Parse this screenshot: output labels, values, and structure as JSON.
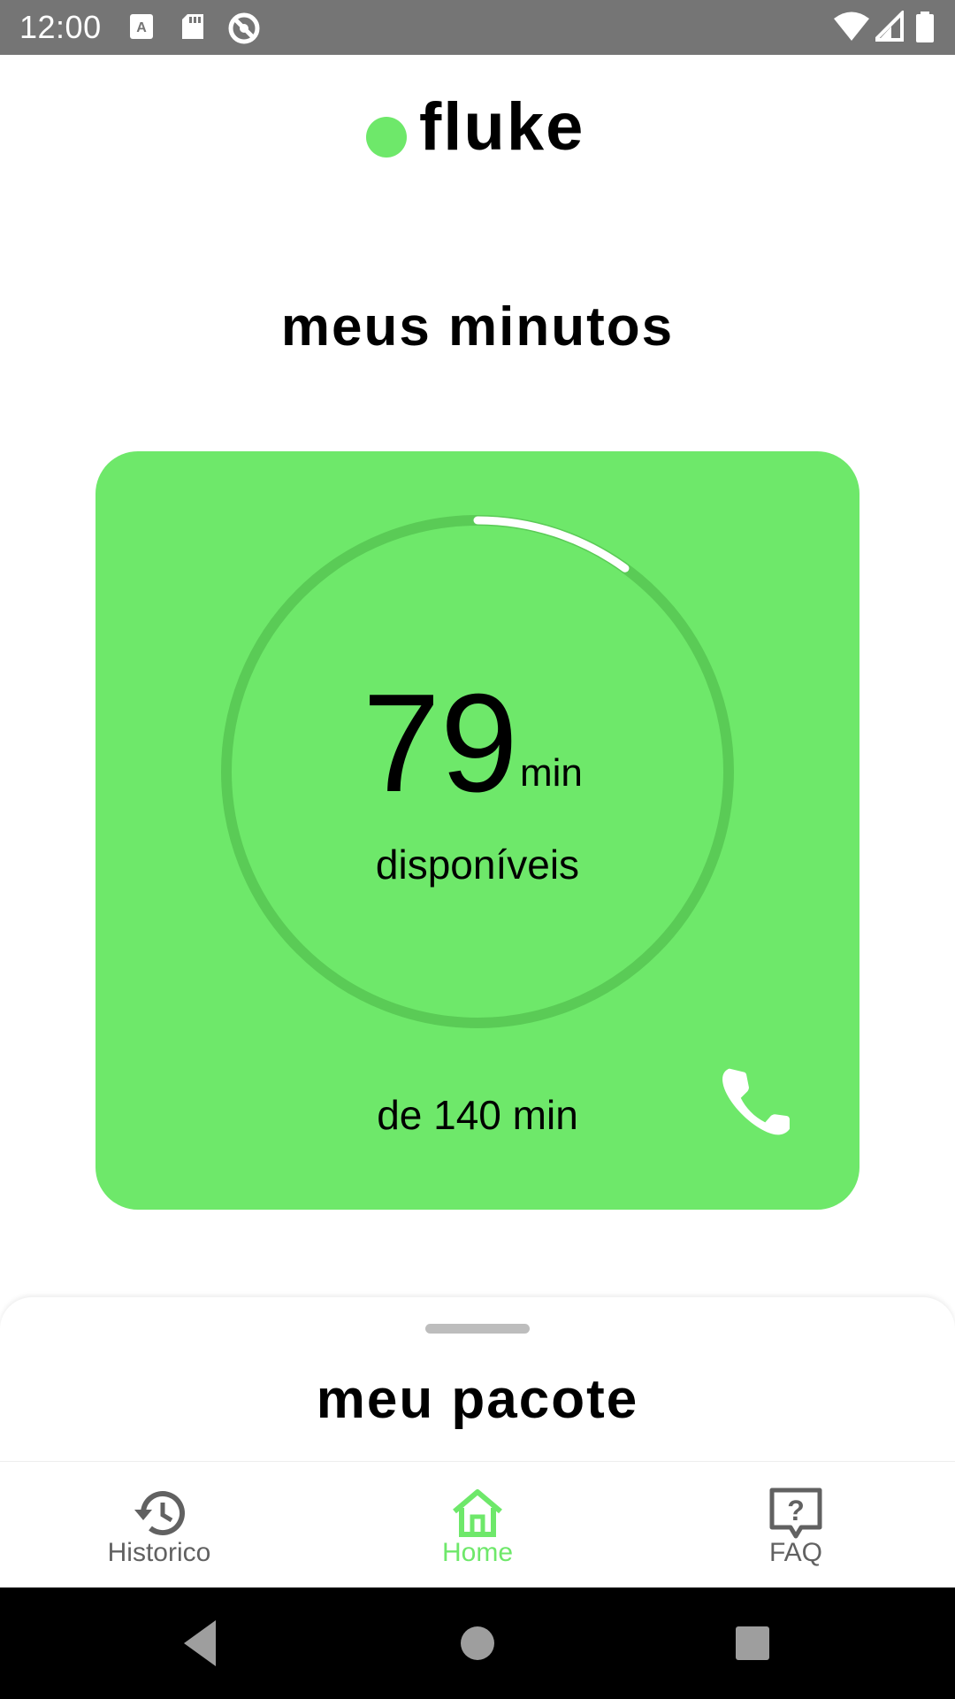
{
  "status_bar": {
    "time": "12:00",
    "icons": [
      "keyboard-icon",
      "sd-card-icon",
      "no-sync-icon",
      "wifi-icon",
      "signal-icon",
      "battery-icon"
    ]
  },
  "header": {
    "logo_text": "fluke",
    "logo_dot_color": "#6ee86a"
  },
  "main": {
    "title": "meus minutos",
    "card": {
      "background_color": "#6ee86a",
      "minutes_value": "79",
      "minutes_unit": "min",
      "available_label": "disponíveis",
      "total_label": "de 140 min",
      "used_fraction": 0.1,
      "action_icon": "phone-icon"
    }
  },
  "sheet": {
    "title": "meu pacote"
  },
  "bottom_nav": {
    "items": [
      {
        "label": "Historico",
        "icon": "history-icon",
        "active": false
      },
      {
        "label": "Home",
        "icon": "home-icon",
        "active": true
      },
      {
        "label": "FAQ",
        "icon": "help-icon",
        "active": false
      }
    ],
    "active_color": "#6ee86a"
  },
  "system_nav": {
    "buttons": [
      "back-icon",
      "home-circle-icon",
      "recents-icon"
    ]
  }
}
